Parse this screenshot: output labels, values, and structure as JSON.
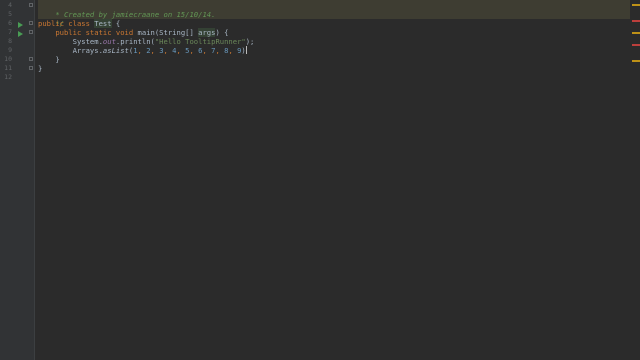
{
  "gutter": {
    "line_numbers": [
      "4",
      "5",
      "6",
      "7",
      "8",
      "9",
      "10",
      "11",
      "12"
    ]
  },
  "code": {
    "line4": "* Created by jamiecraane on 15/10/14.",
    "line5": "*/",
    "line6_kw1": "public",
    "line6_kw2": "class",
    "line6_name": "Test",
    "line6_rest": "{",
    "line7_kw1": "public",
    "line7_kw2": "static",
    "line7_kw3": "void",
    "line7_sig_a": "main(String[]",
    "line7_param": "args",
    "line7_sig_b": ") {",
    "line8_a": "System.",
    "line8_field": "out",
    "line8_b": ".println(",
    "line8_str": "\"Hello TooltipRunner\"",
    "line8_c": ");",
    "line9_a": "Arrays.",
    "line9_method": "asList",
    "line9_open": "(",
    "line9_nums": [
      "1",
      "2",
      "3",
      "4",
      "5",
      "6",
      "7",
      "8",
      "9"
    ],
    "line9_close": ")",
    "line10": "}",
    "line11": "}"
  },
  "colors": {
    "background": "#2b2b2b",
    "gutter": "#313335",
    "keyword": "#cc7832",
    "comment": "#629755",
    "string": "#6a8759",
    "number": "#6897bb",
    "run_icon": "#499c54",
    "error_marker": "#bc3f3c",
    "warning_marker": "#be9117"
  },
  "icons": {
    "run_class": "run-icon",
    "run_method": "run-icon"
  }
}
